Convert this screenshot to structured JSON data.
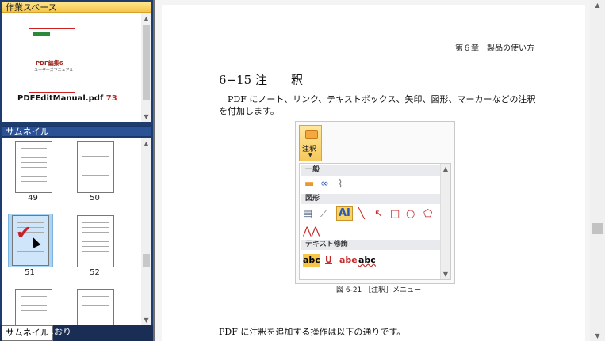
{
  "workspace": {
    "header": "作業スペース",
    "document_name": "PDFEditManual.pdf",
    "page_count": "73",
    "thumb_title": "PDF編集6",
    "thumb_subtitle": "ユーザーズマニュアル"
  },
  "thumbnails": {
    "header": "サムネイル",
    "pages": [
      "49",
      "50",
      "51",
      "52"
    ],
    "selected": "51"
  },
  "tabs": {
    "thumbnail": "サムネイル",
    "bookmark": "しおり"
  },
  "document": {
    "chapter": "第６章　製品の使い方",
    "section_title": "6−15 注　　釈",
    "intro": "PDF にノート、リンク、テキストボックス、矢印、図形、マーカーなどの注釈を付加します。",
    "figure": {
      "button_label": "注釈",
      "groups": [
        "一般",
        "図形",
        "テキスト修飾"
      ],
      "text_tools": [
        "abc",
        "U",
        "abe",
        "abc"
      ],
      "shape_tool_label": "AI"
    },
    "caption": "図 6-21 ［注釈］メニュー",
    "outro": "PDF に注釈を追加する操作は以下の通りです。"
  },
  "colors": {
    "accent": "#2c5296",
    "highlight": "#a8d4f6",
    "workspace_header": "#f5c54a"
  }
}
